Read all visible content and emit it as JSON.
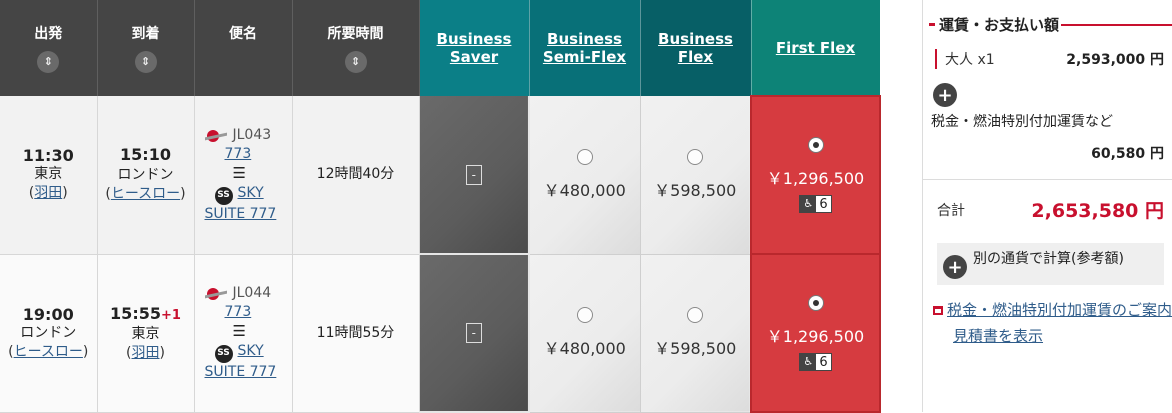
{
  "headers": {
    "departure": "出発",
    "arrival": "到着",
    "flight": "便名",
    "duration": "所要時間",
    "sort_icon": "⇕",
    "fares": [
      "Business Saver",
      "Business Semi-Flex",
      "Business Flex",
      "First Flex"
    ]
  },
  "flights": [
    {
      "dep_time": "11:30",
      "dep_city": "東京",
      "dep_airport": "羽田",
      "arr_time": "15:10",
      "arr_plus": "",
      "arr_city": "ロンドン",
      "arr_airport": "ヒースロー",
      "flight_no": "JL043",
      "aircraft": "773",
      "seat_type_1": "SKY",
      "seat_type_2": "SUITE 777",
      "duration": "12時間40分",
      "saver": "-",
      "semi_flex": "￥480,000",
      "flex": "￥598,500",
      "first_flex": "￥1,296,500",
      "seats_left": "6"
    },
    {
      "dep_time": "19:00",
      "dep_city": "ロンドン",
      "dep_airport": "ヒースロー",
      "arr_time": "15:55",
      "arr_plus": "+1",
      "arr_city": "東京",
      "arr_airport": "羽田",
      "flight_no": "JL044",
      "aircraft": "773",
      "seat_type_1": "SKY",
      "seat_type_2": "SUITE 777",
      "duration": "11時間55分",
      "saver": "-",
      "semi_flex": "￥480,000",
      "flex": "￥598,500",
      "first_flex": "￥1,296,500",
      "seats_left": "6"
    }
  ],
  "sidebar": {
    "title": "運賃・お支払い額",
    "adult_label": "大人 x1",
    "adult_price": "2,593,000 円",
    "tax_label": "税金・燃油特別付加運賃など",
    "tax_price": "60,580 円",
    "total_label": "合計",
    "total_price": "2,653,580 円",
    "currency_label": "別の通貨で計算(参考額)",
    "tax_info_link": "税金・燃油特別付加運賃のご案内",
    "estimate_link": "見積書を表示"
  }
}
